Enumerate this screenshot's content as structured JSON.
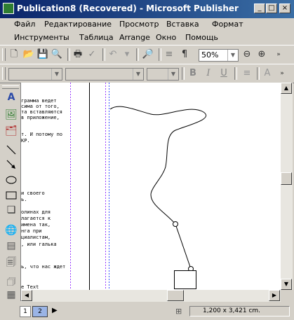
{
  "window": {
    "title": "Publication8 (Recovered) - Microsoft Publisher",
    "minimize": "_",
    "maximize": "□",
    "close": "×"
  },
  "menu": {
    "row1": [
      "Файл",
      "Редактирование",
      "Просмотр",
      "Вставка",
      "Формат"
    ],
    "row2": [
      "Инструменты",
      "Таблица",
      "Arrange",
      "Окно",
      "Помощь"
    ]
  },
  "toolbar": {
    "zoom_value": "50%"
  },
  "document": {
    "lines": [
      "грамма ведет",
      "сима от того,",
      "та вставляются",
      "в приложение,",
      "",
      "т. И потому по",
      "КР.",
      "",
      "",
      "",
      "",
      "",
      "и своего",
      "ь.",
      "",
      "олинах для",
      "лагается к",
      "имена так,",
      "нга при",
      "циалистам,",
      ", или галька",
      "",
      "",
      "ь, что нас ждет",
      "",
      "",
      "e Text"
    ]
  },
  "pages": {
    "page1": "1",
    "page2": "2"
  },
  "status": {
    "position": "1,200 x 3,421 cm."
  }
}
